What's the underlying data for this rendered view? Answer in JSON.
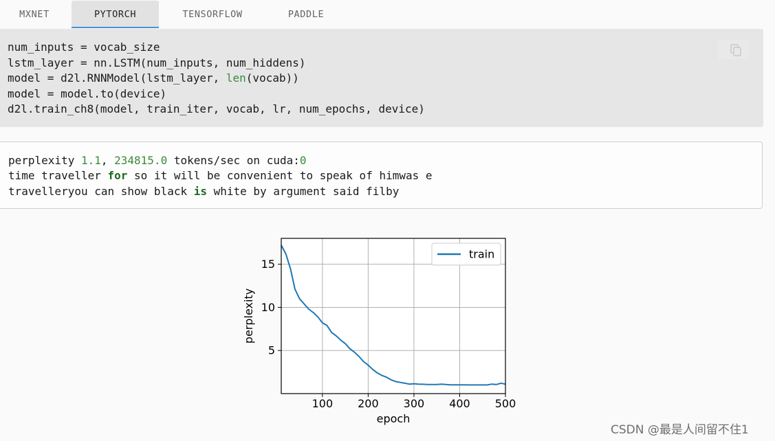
{
  "tabs": [
    {
      "label": "MXNET"
    },
    {
      "label": "PYTORCH"
    },
    {
      "label": "TENSORFLOW"
    },
    {
      "label": "PADDLE"
    }
  ],
  "code": {
    "line1": "num_inputs = vocab_size",
    "line2": "lstm_layer = nn.LSTM(num_inputs, num_hiddens)",
    "line3_a": "model = d2l.RNNModel(lstm_layer, ",
    "line3_b": "len",
    "line3_c": "(vocab))",
    "line4": "model = model.to(device)",
    "line5": "d2l.train_ch8(model, train_iter, vocab, lr, num_epochs, device)"
  },
  "copy_button": {
    "icon": "copy-icon"
  },
  "output": {
    "l1_a": "perplexity ",
    "l1_b": "1.1",
    "l1_c": ", ",
    "l1_d": "234815.0",
    "l1_e": " tokens/sec on cuda:",
    "l1_f": "0",
    "l2_a": "time traveller ",
    "l2_b": "for",
    "l2_c": " so it will be convenient to speak of himwas e",
    "l3_a": "travelleryou can show black ",
    "l3_b": "is",
    "l3_c": " white by argument said filby"
  },
  "chart_data": {
    "type": "line",
    "xlabel": "epoch",
    "ylabel": "perplexity",
    "xlim": [
      10,
      500
    ],
    "ylim": [
      0,
      18
    ],
    "xticks": [
      100,
      200,
      300,
      400,
      500
    ],
    "yticks": [
      5,
      10,
      15
    ],
    "grid": true,
    "legend_position": "top-right",
    "series": [
      {
        "name": "train",
        "color": "#1f77b4",
        "x": [
          10,
          20,
          30,
          40,
          50,
          60,
          70,
          80,
          90,
          100,
          110,
          120,
          130,
          140,
          150,
          160,
          170,
          180,
          190,
          200,
          210,
          220,
          230,
          240,
          250,
          260,
          270,
          280,
          290,
          300,
          310,
          320,
          330,
          340,
          350,
          360,
          370,
          380,
          390,
          400,
          410,
          420,
          430,
          440,
          450,
          460,
          470,
          480,
          490,
          500
        ],
        "y": [
          17.2,
          16.2,
          14.5,
          12.1,
          11.0,
          10.4,
          9.8,
          9.4,
          8.9,
          8.2,
          7.9,
          7.1,
          6.7,
          6.2,
          5.8,
          5.2,
          4.8,
          4.3,
          3.7,
          3.3,
          2.8,
          2.4,
          2.1,
          1.9,
          1.6,
          1.4,
          1.3,
          1.2,
          1.1,
          1.15,
          1.1,
          1.08,
          1.05,
          1.05,
          1.06,
          1.1,
          1.05,
          1.02,
          1.02,
          1.02,
          1.02,
          1.0,
          1.0,
          1.0,
          1.0,
          1.0,
          1.1,
          1.05,
          1.2,
          1.1
        ]
      }
    ]
  },
  "watermark": "CSDN @最是人间留不住1"
}
